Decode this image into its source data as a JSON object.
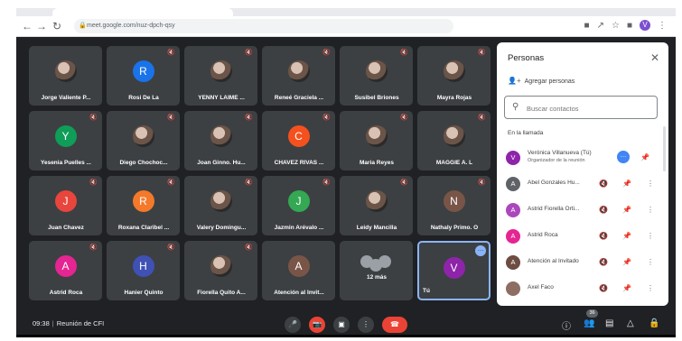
{
  "browser": {
    "url": "meet.google.com/nuz-dpch-qsy",
    "profile_initial": "V"
  },
  "tiles": [
    {
      "name": "Jorge Valiente P...",
      "initial": "",
      "color": "",
      "photo": true,
      "muted": false
    },
    {
      "name": "Rosi De La",
      "initial": "R",
      "color": "#1a73e8",
      "photo": false,
      "muted": true
    },
    {
      "name": "YENNY LAIME ...",
      "initial": "",
      "color": "",
      "photo": true,
      "muted": true
    },
    {
      "name": "Reneé Graciela ...",
      "initial": "",
      "color": "",
      "photo": true,
      "muted": true
    },
    {
      "name": "Susibel Briones",
      "initial": "",
      "color": "",
      "photo": true,
      "muted": true
    },
    {
      "name": "Mayra Rojas",
      "initial": "",
      "color": "",
      "photo": true,
      "muted": true
    },
    {
      "name": "Yesenia Puelles ...",
      "initial": "Y",
      "color": "#0f9d58",
      "photo": false,
      "muted": true
    },
    {
      "name": "Diego Chochoc...",
      "initial": "",
      "color": "",
      "photo": true,
      "muted": true
    },
    {
      "name": "Joan Ginno. Hu...",
      "initial": "",
      "color": "",
      "photo": true,
      "muted": true
    },
    {
      "name": "CHAVEZ RIVAS ...",
      "initial": "C",
      "color": "#f4511e",
      "photo": false,
      "muted": true
    },
    {
      "name": "Maria Reyes",
      "initial": "",
      "color": "",
      "photo": true,
      "muted": true
    },
    {
      "name": "MAGGIE A. L",
      "initial": "",
      "color": "",
      "photo": true,
      "muted": true
    },
    {
      "name": "Juan Chavez",
      "initial": "J",
      "color": "#e8453c",
      "photo": false,
      "muted": true
    },
    {
      "name": "Roxana Claribel ...",
      "initial": "R",
      "color": "#f4792a",
      "photo": false,
      "muted": true
    },
    {
      "name": "Valery Domingu...",
      "initial": "",
      "color": "",
      "photo": true,
      "muted": true
    },
    {
      "name": "Jazmin Arévalo ...",
      "initial": "J",
      "color": "#34a853",
      "photo": false,
      "muted": true
    },
    {
      "name": "Leidy Mancilla",
      "initial": "",
      "color": "",
      "photo": true,
      "muted": true
    },
    {
      "name": "Nathaly Primo. O",
      "initial": "N",
      "color": "#795548",
      "photo": false,
      "muted": true
    },
    {
      "name": "Astrid Roca",
      "initial": "A",
      "color": "#e52592",
      "photo": false,
      "muted": true
    },
    {
      "name": "Hanier Quinto",
      "initial": "H",
      "color": "#3f51b5",
      "photo": false,
      "muted": true
    },
    {
      "name": "Fiorella Quito A...",
      "initial": "",
      "color": "",
      "photo": true,
      "muted": true
    },
    {
      "name": "Atención al Invit...",
      "initial": "A",
      "color": "#795548",
      "photo": false,
      "muted": false
    },
    {
      "name": "12 más",
      "initial": "",
      "color": "",
      "photo": false,
      "muted": false,
      "extra": true
    },
    {
      "name": "Tú",
      "initial": "V",
      "color": "#8e24aa",
      "photo": false,
      "muted": false,
      "self": true
    }
  ],
  "panel": {
    "title": "Personas",
    "add_people": "Agregar personas",
    "search_placeholder": "Buscar contactos",
    "section": "En la llamada",
    "people": [
      {
        "name": "Verónica Villanueva (Tú)",
        "sub": "Organizador de la reunión",
        "initial": "V",
        "color": "#8e24aa",
        "host": true
      },
      {
        "name": "Abel Gonzales Hu...",
        "sub": "",
        "initial": "A",
        "color": "#5f6368",
        "host": false
      },
      {
        "name": "Astrid Fiorella Orti...",
        "sub": "",
        "initial": "A",
        "color": "#ab47bc",
        "host": false
      },
      {
        "name": "Astrid Roca",
        "sub": "",
        "initial": "A",
        "color": "#e52592",
        "host": false
      },
      {
        "name": "Atención al Invitado",
        "sub": "",
        "initial": "A",
        "color": "#6d4c41",
        "host": false
      },
      {
        "name": "Axel Faco",
        "sub": "",
        "initial": "",
        "color": "#8d6e63",
        "host": false
      }
    ]
  },
  "bottom": {
    "time": "09:38",
    "meeting": "Reunión de CFI",
    "participants_count": "36"
  }
}
